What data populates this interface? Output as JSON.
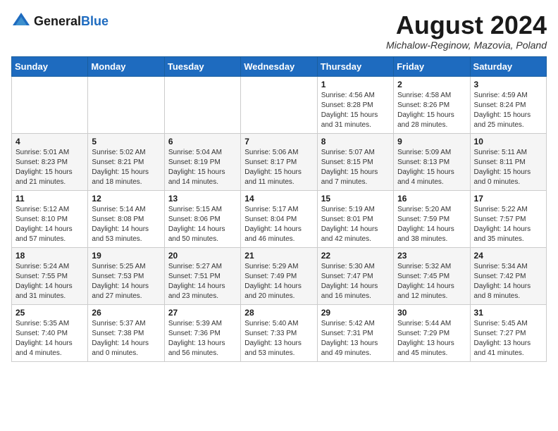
{
  "logo": {
    "general": "General",
    "blue": "Blue"
  },
  "header": {
    "month_year": "August 2024",
    "location": "Michalow-Reginow, Mazovia, Poland"
  },
  "weekdays": [
    "Sunday",
    "Monday",
    "Tuesday",
    "Wednesday",
    "Thursday",
    "Friday",
    "Saturday"
  ],
  "weeks": [
    [
      {
        "day": "",
        "info": ""
      },
      {
        "day": "",
        "info": ""
      },
      {
        "day": "",
        "info": ""
      },
      {
        "day": "",
        "info": ""
      },
      {
        "day": "1",
        "info": "Sunrise: 4:56 AM\nSunset: 8:28 PM\nDaylight: 15 hours\nand 31 minutes."
      },
      {
        "day": "2",
        "info": "Sunrise: 4:58 AM\nSunset: 8:26 PM\nDaylight: 15 hours\nand 28 minutes."
      },
      {
        "day": "3",
        "info": "Sunrise: 4:59 AM\nSunset: 8:24 PM\nDaylight: 15 hours\nand 25 minutes."
      }
    ],
    [
      {
        "day": "4",
        "info": "Sunrise: 5:01 AM\nSunset: 8:23 PM\nDaylight: 15 hours\nand 21 minutes."
      },
      {
        "day": "5",
        "info": "Sunrise: 5:02 AM\nSunset: 8:21 PM\nDaylight: 15 hours\nand 18 minutes."
      },
      {
        "day": "6",
        "info": "Sunrise: 5:04 AM\nSunset: 8:19 PM\nDaylight: 15 hours\nand 14 minutes."
      },
      {
        "day": "7",
        "info": "Sunrise: 5:06 AM\nSunset: 8:17 PM\nDaylight: 15 hours\nand 11 minutes."
      },
      {
        "day": "8",
        "info": "Sunrise: 5:07 AM\nSunset: 8:15 PM\nDaylight: 15 hours\nand 7 minutes."
      },
      {
        "day": "9",
        "info": "Sunrise: 5:09 AM\nSunset: 8:13 PM\nDaylight: 15 hours\nand 4 minutes."
      },
      {
        "day": "10",
        "info": "Sunrise: 5:11 AM\nSunset: 8:11 PM\nDaylight: 15 hours\nand 0 minutes."
      }
    ],
    [
      {
        "day": "11",
        "info": "Sunrise: 5:12 AM\nSunset: 8:10 PM\nDaylight: 14 hours\nand 57 minutes."
      },
      {
        "day": "12",
        "info": "Sunrise: 5:14 AM\nSunset: 8:08 PM\nDaylight: 14 hours\nand 53 minutes."
      },
      {
        "day": "13",
        "info": "Sunrise: 5:15 AM\nSunset: 8:06 PM\nDaylight: 14 hours\nand 50 minutes."
      },
      {
        "day": "14",
        "info": "Sunrise: 5:17 AM\nSunset: 8:04 PM\nDaylight: 14 hours\nand 46 minutes."
      },
      {
        "day": "15",
        "info": "Sunrise: 5:19 AM\nSunset: 8:01 PM\nDaylight: 14 hours\nand 42 minutes."
      },
      {
        "day": "16",
        "info": "Sunrise: 5:20 AM\nSunset: 7:59 PM\nDaylight: 14 hours\nand 38 minutes."
      },
      {
        "day": "17",
        "info": "Sunrise: 5:22 AM\nSunset: 7:57 PM\nDaylight: 14 hours\nand 35 minutes."
      }
    ],
    [
      {
        "day": "18",
        "info": "Sunrise: 5:24 AM\nSunset: 7:55 PM\nDaylight: 14 hours\nand 31 minutes."
      },
      {
        "day": "19",
        "info": "Sunrise: 5:25 AM\nSunset: 7:53 PM\nDaylight: 14 hours\nand 27 minutes."
      },
      {
        "day": "20",
        "info": "Sunrise: 5:27 AM\nSunset: 7:51 PM\nDaylight: 14 hours\nand 23 minutes."
      },
      {
        "day": "21",
        "info": "Sunrise: 5:29 AM\nSunset: 7:49 PM\nDaylight: 14 hours\nand 20 minutes."
      },
      {
        "day": "22",
        "info": "Sunrise: 5:30 AM\nSunset: 7:47 PM\nDaylight: 14 hours\nand 16 minutes."
      },
      {
        "day": "23",
        "info": "Sunrise: 5:32 AM\nSunset: 7:45 PM\nDaylight: 14 hours\nand 12 minutes."
      },
      {
        "day": "24",
        "info": "Sunrise: 5:34 AM\nSunset: 7:42 PM\nDaylight: 14 hours\nand 8 minutes."
      }
    ],
    [
      {
        "day": "25",
        "info": "Sunrise: 5:35 AM\nSunset: 7:40 PM\nDaylight: 14 hours\nand 4 minutes."
      },
      {
        "day": "26",
        "info": "Sunrise: 5:37 AM\nSunset: 7:38 PM\nDaylight: 14 hours\nand 0 minutes."
      },
      {
        "day": "27",
        "info": "Sunrise: 5:39 AM\nSunset: 7:36 PM\nDaylight: 13 hours\nand 56 minutes."
      },
      {
        "day": "28",
        "info": "Sunrise: 5:40 AM\nSunset: 7:33 PM\nDaylight: 13 hours\nand 53 minutes."
      },
      {
        "day": "29",
        "info": "Sunrise: 5:42 AM\nSunset: 7:31 PM\nDaylight: 13 hours\nand 49 minutes."
      },
      {
        "day": "30",
        "info": "Sunrise: 5:44 AM\nSunset: 7:29 PM\nDaylight: 13 hours\nand 45 minutes."
      },
      {
        "day": "31",
        "info": "Sunrise: 5:45 AM\nSunset: 7:27 PM\nDaylight: 13 hours\nand 41 minutes."
      }
    ]
  ]
}
